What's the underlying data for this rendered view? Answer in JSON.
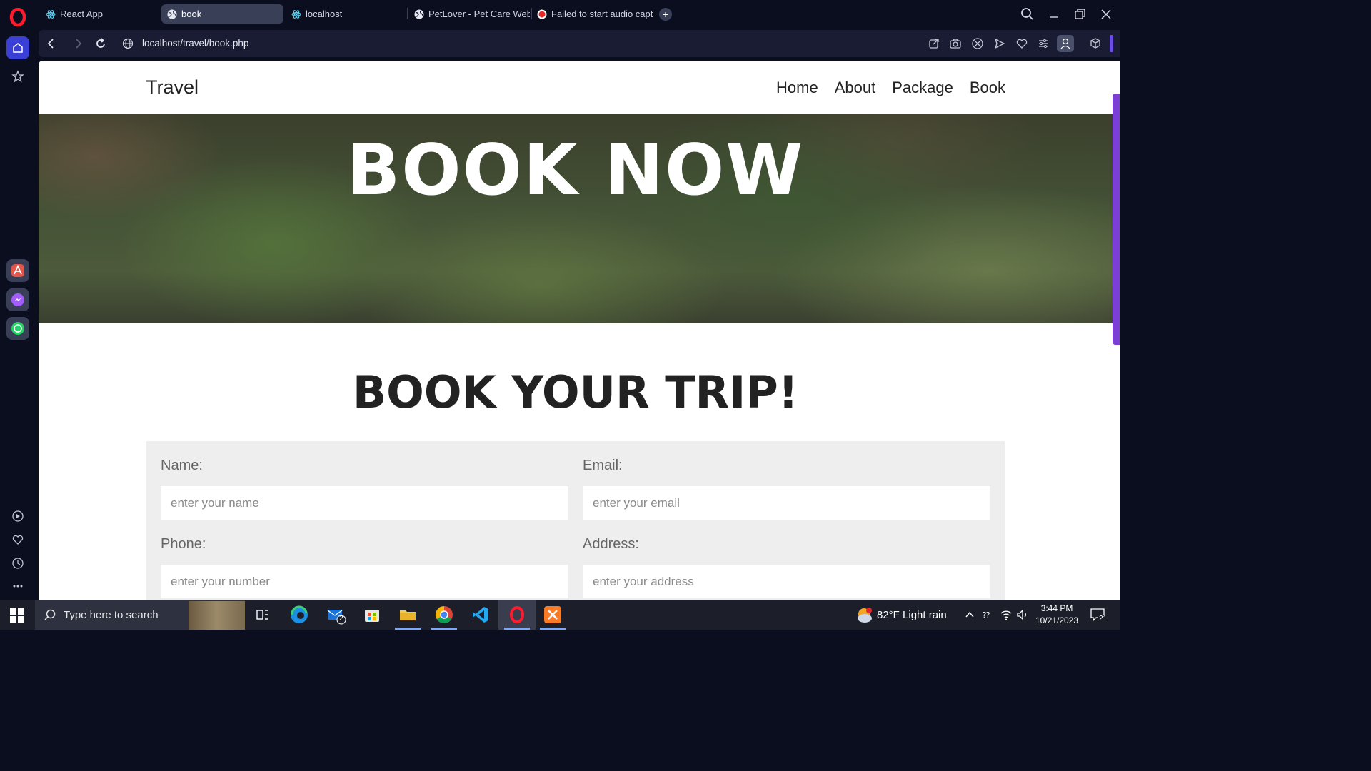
{
  "browser": {
    "tabs": [
      {
        "label": "React App",
        "icon": "react-icon"
      },
      {
        "label": "book",
        "icon": "globe-icon",
        "active": true
      },
      {
        "label": "localhost",
        "icon": "react-icon"
      },
      {
        "label": "PetLover - Pet Care Websi",
        "icon": "globe-icon"
      },
      {
        "label": "Failed to start audio captu",
        "icon": "record-icon"
      }
    ],
    "new_tab": "+",
    "url": "localhost/travel/book.php",
    "accent": "#3a3fd6"
  },
  "site": {
    "brand": "Travel",
    "nav": [
      "Home",
      "About",
      "Package",
      "Book"
    ],
    "hero_title": "BOOK NOW",
    "section_title": "BOOK YOUR TRIP!",
    "form": {
      "name_label": "Name:",
      "name_placeholder": "enter your name",
      "email_label": "Email:",
      "email_placeholder": "enter your email",
      "phone_label": "Phone:",
      "phone_placeholder": "enter your number",
      "address_label": "Address:",
      "address_placeholder": "enter your address"
    }
  },
  "taskbar": {
    "search_placeholder": "Type here to search",
    "mail_badge": "2",
    "weather": "82°F  Light rain",
    "time": "3:44 PM",
    "date": "10/21/2023",
    "notifications": "21"
  }
}
